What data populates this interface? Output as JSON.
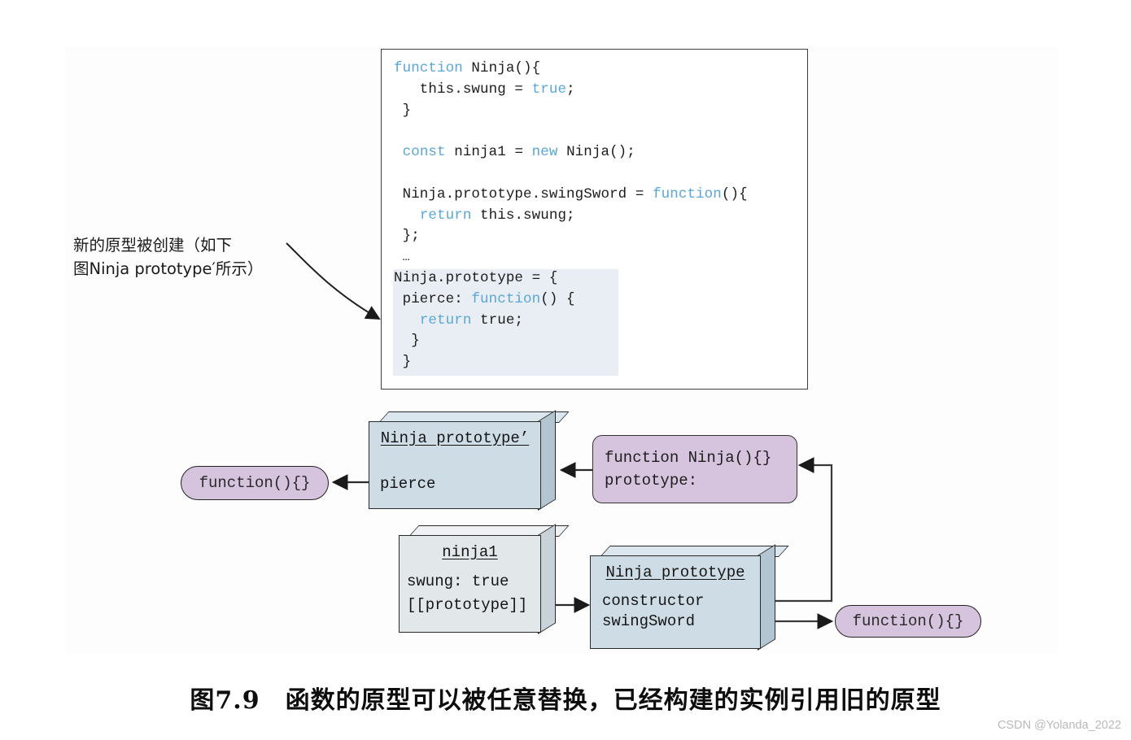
{
  "figure": {
    "caption": "图7.9　函数的原型可以被任意替换，已经构建的实例引用旧的原型",
    "watermark": "CSDN @Yolanda_2022"
  },
  "annotation": {
    "line1": "新的原型被创建（如下",
    "line2": "图Ninja prototype′所示）"
  },
  "code": {
    "lines": [
      "function Ninja(){",
      "   this.swung = true;",
      " }",
      "",
      " const ninja1 = new Ninja();",
      "",
      " Ninja.prototype.swingSword = function(){",
      "   return this.swung;",
      " };",
      " …",
      "Ninja.prototype = {",
      " pierce: function() {",
      "   return true;",
      "  }",
      " }"
    ],
    "keywords": [
      "function",
      "true",
      "const",
      "new",
      "return"
    ],
    "highlight_start_line": 11
  },
  "diagram": {
    "ninja_prototype_prime": {
      "title": "Ninja prototype’",
      "rows": [
        "pierce"
      ]
    },
    "pierce_function": {
      "label": "function(){}"
    },
    "ninja_constructor": {
      "line1": "function Ninja(){}",
      "line2": "prototype:"
    },
    "ninja1_instance": {
      "title": "ninja1",
      "rows": [
        "swung: true",
        "[[prototype]]"
      ]
    },
    "ninja_prototype_old": {
      "title": "Ninja prototype",
      "rows": [
        "constructor",
        "swingSword"
      ]
    },
    "swingsword_function": {
      "label": "function(){}"
    }
  },
  "colors": {
    "box_face": "#cedce6",
    "box_side": "#b4c5d2",
    "box_top": "#dbe6ee",
    "pill_purple": "#d6c4df",
    "instance_face": "#e2e7ea",
    "code_highlight": "#e8eef3",
    "keyword_blue": "#5aa6d6",
    "wire": "#3a3a3a"
  }
}
